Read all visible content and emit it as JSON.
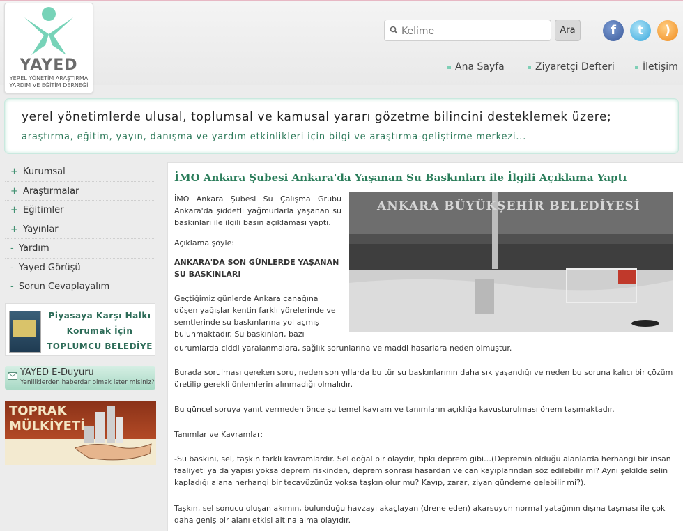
{
  "header": {
    "logo": {
      "brand": "YAYED",
      "subtitle_line1": "YEREL YÖNETİM ARAŞTIRMA",
      "subtitle_line2": "YARDIM VE EĞİTİM DERNEĞİ"
    },
    "search": {
      "placeholder": "Kelime",
      "button_label": "Ara"
    },
    "social": [
      "facebook-icon",
      "twitter-icon",
      "rss-icon"
    ],
    "nav": [
      {
        "label": "Ana Sayfa"
      },
      {
        "label": "Ziyaretçi Defteri"
      },
      {
        "label": "İletişim"
      }
    ]
  },
  "banner": {
    "line1": "yerel yönetimlerde ulusal, toplumsal ve kamusal yararı gözetme bilincini desteklemek üzere;",
    "line2": "araştırma, eğitim, yayın, danışma ve yardım etkinlikleri için bilgi ve araştırma-geliştirme merkezi..."
  },
  "sidebar": {
    "menu": [
      {
        "prefix": "+",
        "label": "Kurumsal"
      },
      {
        "prefix": "+",
        "label": "Araştırmalar"
      },
      {
        "prefix": "+",
        "label": "Eğitimler"
      },
      {
        "prefix": "+",
        "label": "Yayınlar"
      },
      {
        "prefix": "-",
        "label": "Yardım"
      },
      {
        "prefix": "-",
        "label": "Yayed Görüşü"
      },
      {
        "prefix": "-",
        "label": "Sorun Cevaplayalım"
      }
    ],
    "piyasa": {
      "line1": "Piyasaya Karşı Halkı",
      "line2": "Korumak İçin",
      "line3": "TOPLUMCU BELEDİYE"
    },
    "eduyuru": {
      "title": "YAYED E-Duyuru",
      "subtitle": "Yeniliklerden haberdar olmak ister misiniz?"
    },
    "toprak": {
      "line1": "TOPRAK",
      "line2": "MÜLKİYETİ"
    }
  },
  "article": {
    "title": "İMO Ankara Şubesi Ankara'da Yaşanan Su Baskınları ile İlgili Açıklama Yaptı",
    "photo_sign": "ANKARA BÜYÜKŞEHİR BELEDİYESİ",
    "intro": "İMO Ankara Şubesi Su Çalışma Grubu Ankara'da şiddetli yağmurlarla yaşanan su baskınları ile ilgili basın açıklaması yaptı.",
    "lead": "Açıklama şöyle:",
    "heading": "ANKARA'DA SON GÜNLERDE YAŞANAN SU BASKINLARI",
    "p1_narrow": "Geçtiğimiz günlerde Ankara çanağına düşen yağışlar kentin farklı yörelerinde ve semtlerinde su baskınlarına yol açmış bulunmaktadır. Su baskınları, bazı",
    "p1_wide": "durumlarda ciddi yaralanmalara, sağlık sorunlarına ve maddi hasarlara neden olmuştur.",
    "p2": "Burada sorulması gereken soru, neden son yıllarda bu tür su baskınlarının daha sık yaşandığı ve neden bu soruna kalıcı bir çözüm üretilip gerekli önlemlerin alınmadığı olmalıdır.",
    "p3": "Bu güncel soruya yanıt vermeden önce şu temel kavram ve tanımların açıklığa kavuşturulması önem taşımaktadır.",
    "p4": "Tanımlar ve Kavramlar:",
    "p5": "-Su baskını, sel, taşkın farklı kavramlardır. Sel doğal bir olaydır, tıpkı deprem gibi…(Depremin olduğu alanlarda herhangi bir insan faaliyeti ya da yapısı yoksa deprem riskinden, deprem sonrası hasardan ve can kayıplarından söz edilebilir mi? Aynı şekilde selin kapladığı alana herhangi bir tecavüzünüz yoksa taşkın olur mu? Kayıp, zarar, ziyan gündeme gelebilir mi?).",
    "p6": "Taşkın, sel sonucu oluşan akımın, bulunduğu havzayı akaçlayan (drene eden) akarsuyun normal yatağının dışına taşması ile çok daha geniş bir alanı etkisi altına alma olayıdır."
  }
}
